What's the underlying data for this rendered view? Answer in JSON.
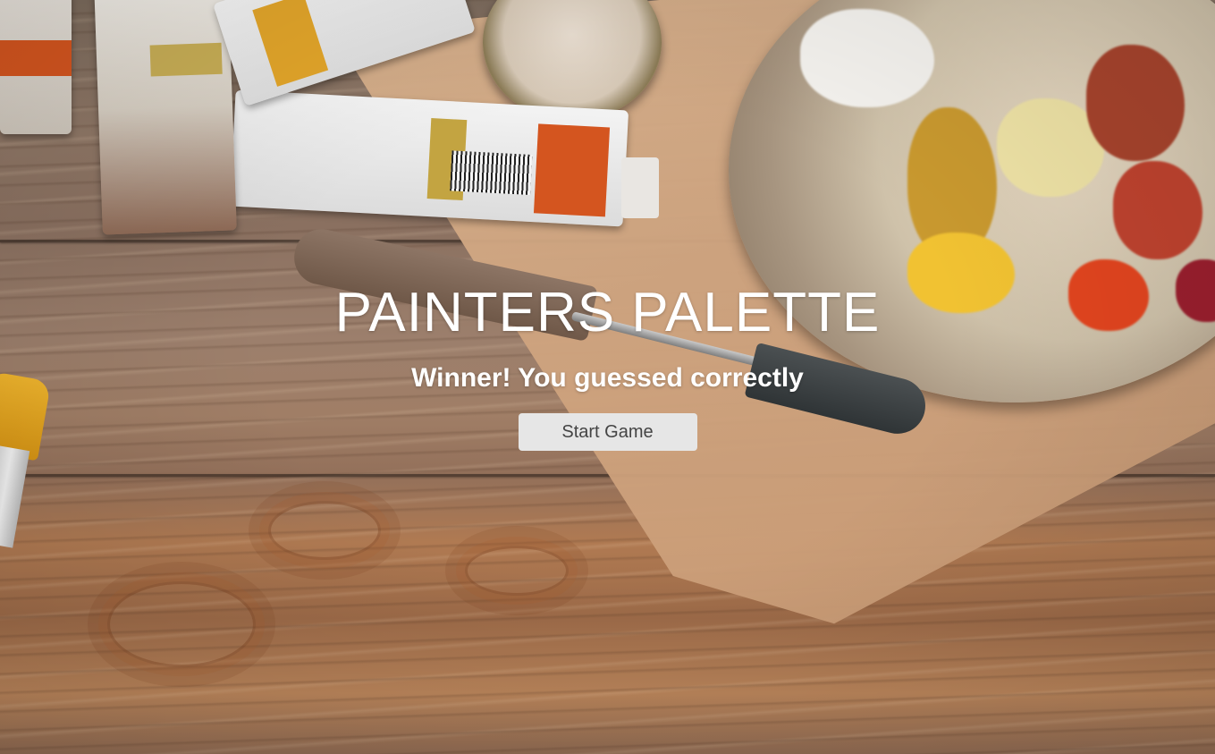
{
  "app": {
    "title": "PAINTERS PALETTE",
    "status_message": "Winner! You guessed correctly",
    "start_button_label": "Start Game"
  },
  "colors": {
    "title_text": "#ffffff",
    "button_background": "#e6e6e6",
    "button_text": "#444444"
  }
}
